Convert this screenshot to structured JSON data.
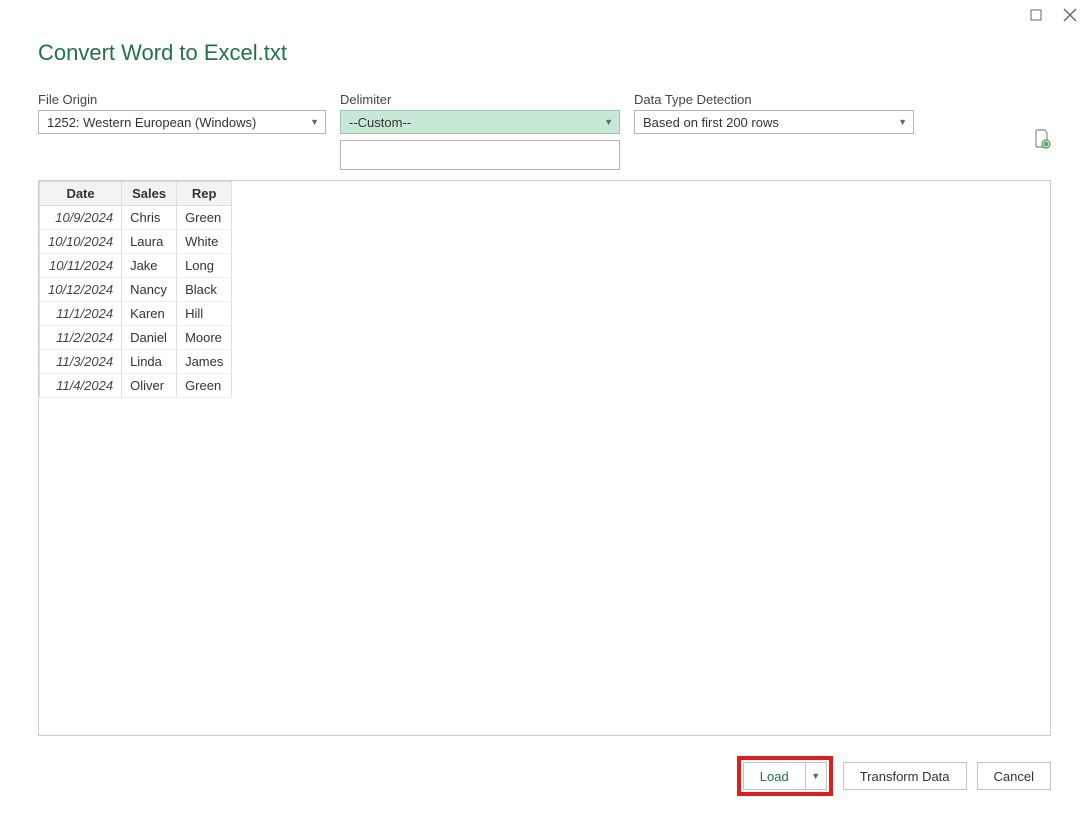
{
  "title": "Convert Word to Excel.txt",
  "labels": {
    "file_origin": "File Origin",
    "delimiter": "Delimiter",
    "data_type": "Data Type Detection"
  },
  "values": {
    "file_origin": "1252: Western European (Windows)",
    "delimiter": "--Custom--",
    "data_type": "Based on first 200 rows",
    "custom_delimiter": ""
  },
  "table": {
    "headers": [
      "Date",
      "Sales",
      "Rep"
    ],
    "rows": [
      {
        "date": "10/9/2024",
        "sales": "Chris",
        "rep": "Green"
      },
      {
        "date": "10/10/2024",
        "sales": "Laura",
        "rep": "White"
      },
      {
        "date": "10/11/2024",
        "sales": "Jake",
        "rep": "Long"
      },
      {
        "date": "10/12/2024",
        "sales": "Nancy",
        "rep": "Black"
      },
      {
        "date": "11/1/2024",
        "sales": "Karen",
        "rep": "Hill"
      },
      {
        "date": "11/2/2024",
        "sales": "Daniel",
        "rep": "Moore"
      },
      {
        "date": "11/3/2024",
        "sales": "Linda",
        "rep": "James"
      },
      {
        "date": "11/4/2024",
        "sales": "Oliver",
        "rep": "Green"
      }
    ]
  },
  "buttons": {
    "load": "Load",
    "transform": "Transform Data",
    "cancel": "Cancel"
  }
}
